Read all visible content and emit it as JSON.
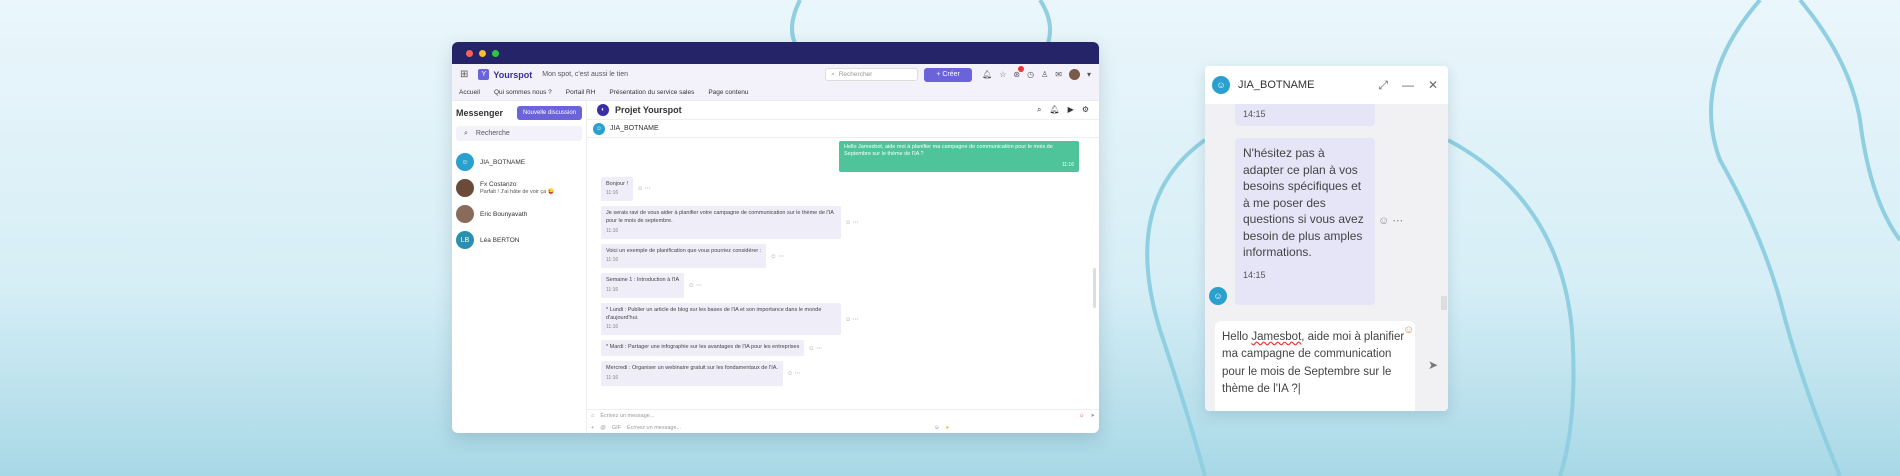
{
  "app": {
    "brand": "Yourspot",
    "slogan": "Mon spot, c'est aussi le tien",
    "search_placeholder": "Rechercher",
    "create_label": "+ Créer",
    "notif_count": "1"
  },
  "nav": [
    "Accueil",
    "Qui sommes nous ?",
    "Portail RH",
    "Présentation du service sales",
    "Page contenu"
  ],
  "messenger": {
    "title": "Messenger",
    "new_label": "Nouvelle discussion",
    "search_placeholder": "Recherche",
    "contacts": [
      {
        "name": "JIA_BOTNAME",
        "sub": "",
        "initials": "",
        "color": "#2aa0cf"
      },
      {
        "name": "Fx Costanzo",
        "sub": "Parfait ! J'ai hâte de voir ça 😜",
        "initials": "",
        "color": "#6b4a3a"
      },
      {
        "name": "Eric Bounyavath",
        "sub": "",
        "initials": "",
        "color": "#8a6a5a"
      },
      {
        "name": "Léa BERTON",
        "sub": "",
        "initials": "LB",
        "color": "#2a8fb0"
      }
    ]
  },
  "conversation": {
    "title": "Projet Yourspot",
    "bot_name": "JIA_BOTNAME",
    "my_message": "Hello Jamesbot, aide moi à planifier ma campagne de communication pour le mois de Septembre sur le thème de l'IA ?",
    "my_time": "11:16",
    "replies": [
      {
        "text": "Bonjour !",
        "time": "11:16"
      },
      {
        "text": "Je serais ravi de vous aider à planifier votre campagne de communication sur le thème de l'IA pour le mois de septembre.",
        "time": "11:16"
      },
      {
        "text": "Voici un exemple de planification que vous pourriez considérer :",
        "time": "11:16"
      },
      {
        "text": "Semaine 1 : Introduction à l'IA",
        "time": "11:16"
      },
      {
        "text": "* Lundi : Publier un article de blog sur les bases de l'IA et son importance dans le monde d'aujourd'hui.",
        "time": "11:16"
      },
      {
        "text": "* Mardi : Partager une infographie sur les avantages de l'IA pour les entreprises",
        "time": ""
      },
      {
        "text": "Mercredi : Organiser un webinaire gratuit sur les fondamentaux de l'IA.",
        "time": "11:16"
      }
    ],
    "input_placeholder": "Écrivez un message...",
    "input_placeholder_2": "Écrivez un message...",
    "gif_label": "GIF"
  },
  "widget": {
    "bot_name": "JIA_BOTNAME",
    "prev_time": "14:15",
    "message": "N'hésitez pas à adapter ce plan à vos besoins spécifiques et à me poser des questions si vous avez besoin de plus amples informations.",
    "message_time": "14:15",
    "input_text_before": "Hello ",
    "input_misspelled": "Jamesbot",
    "input_text_after": ", aide moi à planifier ma campagne de communication pour le mois de Septembre sur le thème de l'IA ?"
  }
}
